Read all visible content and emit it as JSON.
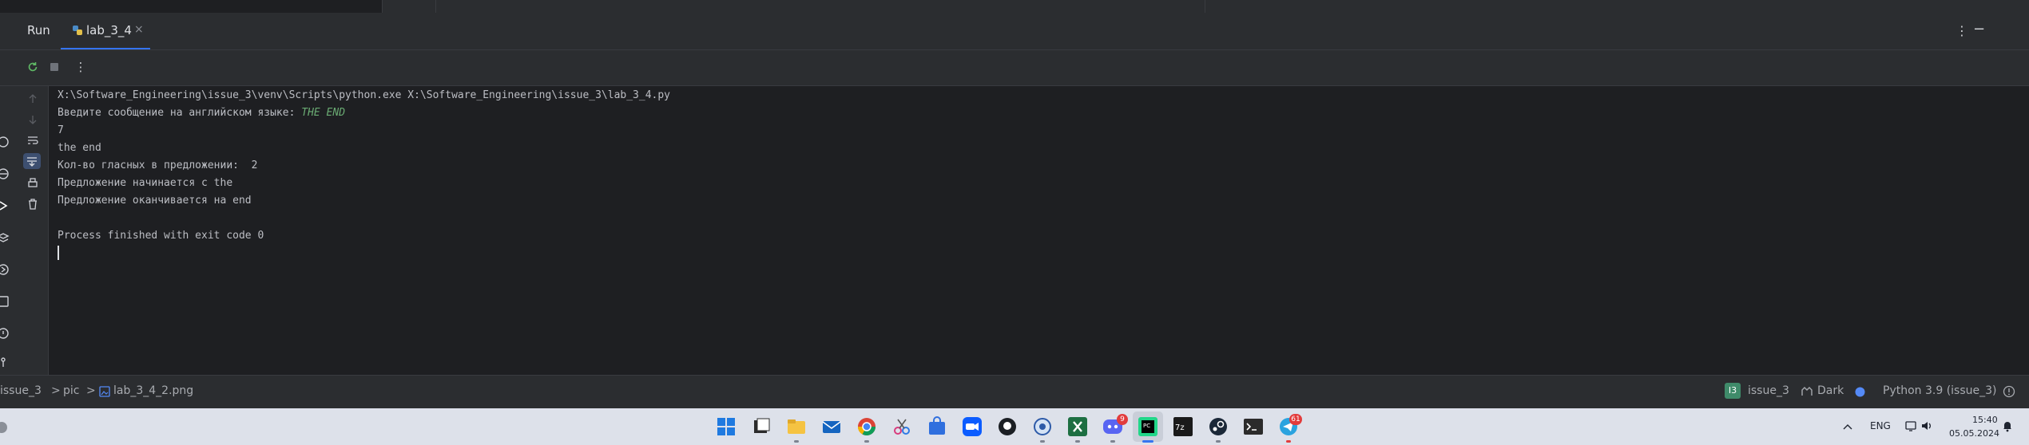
{
  "header": {
    "tool_window_title": "Run",
    "tab_label": "lab_3_4",
    "close_glyph": "×",
    "more_glyph": "⋮",
    "minimize_glyph": "−"
  },
  "toolbar": {
    "icons": [
      "rerun-icon",
      "stop-icon",
      "more-vertical-icon"
    ]
  },
  "console": {
    "lines": [
      "X:\\Software_Engineering\\issue_3\\venv\\Scripts\\python.exe X:\\Software_Engineering\\issue_3\\lab_3_4.py",
      "Введите сообщение на английском языке: ",
      "7",
      "the end",
      "Кол-во гласных в предложении:  2",
      "Предложение начинается с the",
      "Предложение оканчивается на end",
      "",
      "Process finished with exit code 0"
    ],
    "user_input": "THE END"
  },
  "statusbar": {
    "breadcrumb": [
      "issue_3",
      "pic",
      "lab_3_4_2.png"
    ],
    "separator": ">",
    "project_badge": "I3",
    "project": "issue_3",
    "theme": "Dark",
    "interpreter": "Python 3.9 (issue_3)"
  },
  "taskbar": {
    "language": "ENG",
    "time": "15:40",
    "date": "05.05.2024",
    "discord_badge": "9",
    "telegram_badge": "61"
  },
  "colors": {
    "accent": "#3574f0",
    "input_text": "#6aab73",
    "panel": "#2b2d30",
    "console_bg": "#1e1f22"
  }
}
